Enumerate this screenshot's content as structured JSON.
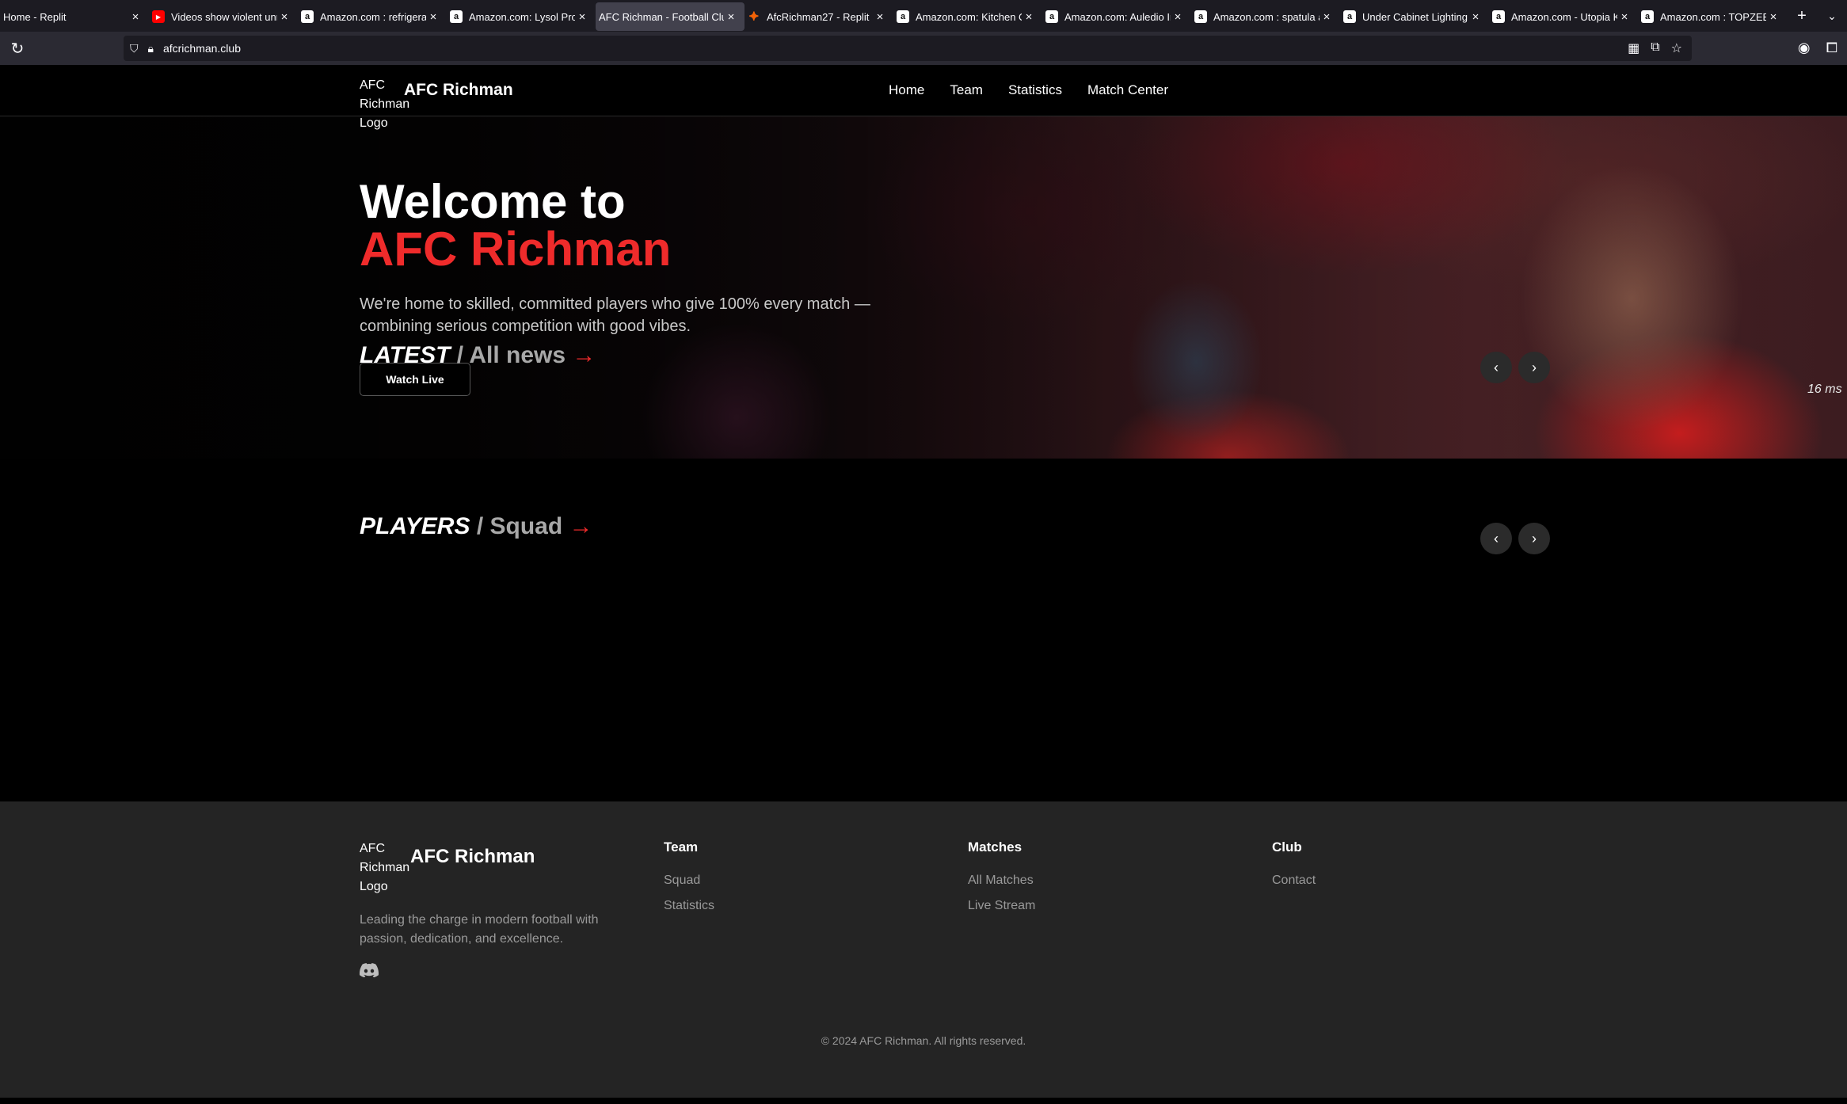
{
  "browser": {
    "tabs": [
      {
        "title": "Home - Replit",
        "favicon": "none",
        "active": false
      },
      {
        "title": "Videos show violent unr",
        "favicon": "youtube",
        "active": false
      },
      {
        "title": "Amazon.com : refrigerat",
        "favicon": "amazon",
        "active": false
      },
      {
        "title": "Amazon.com: Lysol Pro K",
        "favicon": "amazon",
        "active": false
      },
      {
        "title": "AFC Richman - Football Club",
        "favicon": "none",
        "active": true
      },
      {
        "title": "AfcRichman27 - Replit",
        "favicon": "replit",
        "active": false
      },
      {
        "title": "Amazon.com: Kitchen Or",
        "favicon": "amazon",
        "active": false
      },
      {
        "title": "Amazon.com: Auledio Ir",
        "favicon": "amazon",
        "active": false
      },
      {
        "title": "Amazon.com : spatula ar",
        "favicon": "amazon",
        "active": false
      },
      {
        "title": "Under Cabinet Lighting,",
        "favicon": "amazon",
        "active": false
      },
      {
        "title": "Amazon.com - Utopia Ki",
        "favicon": "amazon",
        "active": false
      },
      {
        "title": "Amazon.com : TOPZEE E",
        "favicon": "amazon",
        "active": false
      }
    ],
    "url": "afcrichman.club"
  },
  "header": {
    "logo_alt": "AFC Richman Logo",
    "brand": "AFC Richman",
    "nav": [
      "Home",
      "Team",
      "Statistics",
      "Match Center"
    ]
  },
  "hero": {
    "title_line1": "Welcome to",
    "title_line2": "AFC Richman",
    "lead": "We're home to skilled, committed players who give 100% every match — combining serious competition with good vibes.",
    "cta": "Watch Live",
    "overlay_text": "16 ms"
  },
  "sections": {
    "latest": {
      "title": "LATEST",
      "sub": "/ All news",
      "arrow": "→"
    },
    "players": {
      "title": "PLAYERS",
      "sub": "/ Squad",
      "arrow": "→"
    },
    "prev": "‹",
    "next": "›"
  },
  "footer": {
    "logo_alt": "AFC Richman Logo",
    "brand": "AFC Richman",
    "description": "Leading the charge in modern football with passion, dedication, and excellence.",
    "columns": [
      {
        "heading": "Team",
        "links": [
          "Squad",
          "Statistics"
        ]
      },
      {
        "heading": "Matches",
        "links": [
          "All Matches",
          "Live Stream"
        ]
      },
      {
        "heading": "Club",
        "links": [
          "Contact"
        ]
      }
    ],
    "copyright": "© 2024 AFC Richman. All rights reserved."
  },
  "colors": {
    "accent": "#ef2b2b",
    "background": "#000000",
    "footer": "#242424"
  }
}
